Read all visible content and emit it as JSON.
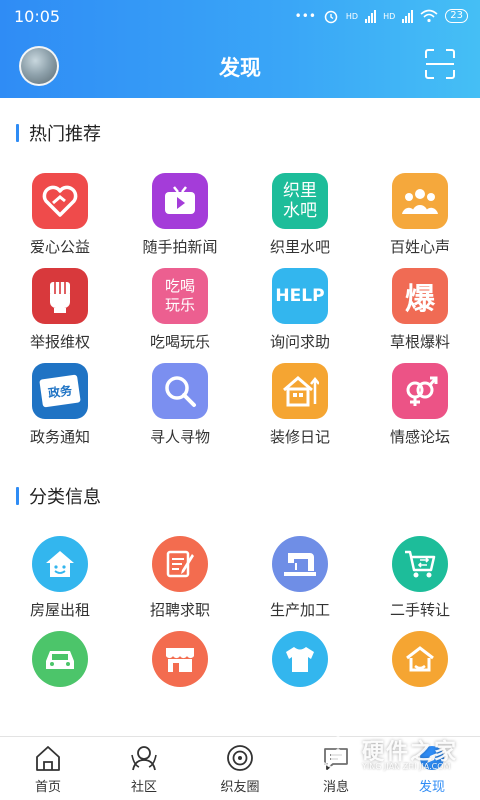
{
  "status": {
    "time": "10:05",
    "network_label": "HD",
    "battery": "23"
  },
  "header": {
    "title": "发现"
  },
  "colors": {
    "brand": "#2f8cf5",
    "header_gradient": [
      "#2f8cf5",
      "#45bff5"
    ]
  },
  "hot": {
    "title": "热门推荐",
    "items": [
      {
        "label": "爱心公益",
        "icon": "heart-icon",
        "color": "#ef4b4b"
      },
      {
        "label": "随手拍新闻",
        "icon": "tv-icon",
        "color": "#a43cd9"
      },
      {
        "label": "织里水吧",
        "icon": "text-icon",
        "icon_text": "织里\n水吧",
        "color": "#1dbd9a"
      },
      {
        "label": "百姓心声",
        "icon": "people-icon",
        "color": "#f5a83c"
      },
      {
        "label": "举报维权",
        "icon": "fist-icon",
        "color": "#d8393c"
      },
      {
        "label": "吃喝玩乐",
        "icon": "text-icon",
        "icon_text": "吃喝\n玩乐",
        "color": "#ec5f90"
      },
      {
        "label": "询问求助",
        "icon": "help-icon",
        "icon_text": "HELP",
        "color": "#33b6ee"
      },
      {
        "label": "草根爆料",
        "icon": "text-icon",
        "icon_text": "爆",
        "color": "#f06b54"
      },
      {
        "label": "政务通知",
        "icon": "government-icon",
        "icon_text": "政务",
        "color": "#1f73c4"
      },
      {
        "label": "寻人寻物",
        "icon": "magnifier-icon",
        "color": "#7b8ff0"
      },
      {
        "label": "装修日记",
        "icon": "house-icon",
        "color": "#f5a532"
      },
      {
        "label": "情感论坛",
        "icon": "gender-icon",
        "color": "#ec5386"
      }
    ]
  },
  "classified": {
    "title": "分类信息",
    "items": [
      {
        "label": "房屋出租",
        "icon": "house-face-icon",
        "color": "#33b6ee"
      },
      {
        "label": "招聘求职",
        "icon": "notepad-icon",
        "color": "#f36c4f"
      },
      {
        "label": "生产加工",
        "icon": "sewing-machine-icon",
        "color": "#6f8ee6"
      },
      {
        "label": "二手转让",
        "icon": "cart-icon",
        "color": "#1dbd9a"
      },
      {
        "label": "",
        "icon": "car-icon",
        "color": "#4cc56a"
      },
      {
        "label": "",
        "icon": "shop-icon",
        "color": "#f36c4f"
      },
      {
        "label": "",
        "icon": "shirt-icon",
        "color": "#33b6ee"
      },
      {
        "label": "",
        "icon": "home-deal-icon",
        "color": "#f5a532"
      }
    ]
  },
  "bottom_nav": [
    {
      "label": "首页",
      "icon": "home-icon",
      "active": false
    },
    {
      "label": "社区",
      "icon": "community-icon",
      "active": false
    },
    {
      "label": "织友圈",
      "icon": "circle-icon",
      "active": false
    },
    {
      "label": "消息",
      "icon": "message-icon",
      "active": false
    },
    {
      "label": "发现",
      "icon": "discover-icon",
      "active": true
    }
  ],
  "watermark": {
    "brand": "硬件之家",
    "pinyin": "YING JIAN ZHI JIA.COM"
  }
}
